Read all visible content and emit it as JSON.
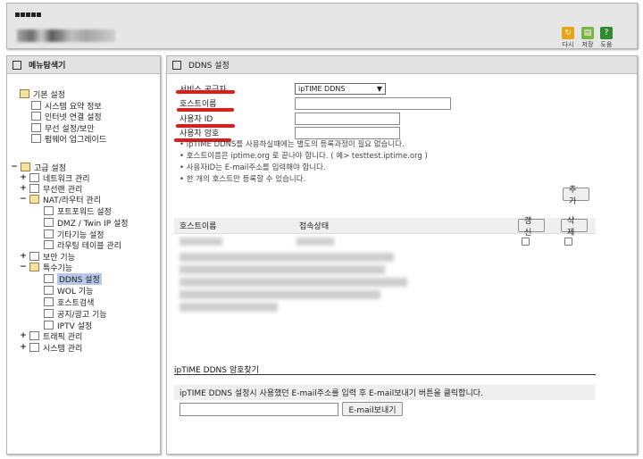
{
  "header": {
    "buttons": [
      {
        "label": "다시",
        "icon": "refresh-icon",
        "color": "#e8a317"
      },
      {
        "label": "저장",
        "icon": "save-icon",
        "color": "#7cb342"
      },
      {
        "label": "도움",
        "icon": "help-icon",
        "color": "#2e8b2e"
      }
    ]
  },
  "sidebar": {
    "title": "메뉴탐색기",
    "basic": {
      "label": "기본 설정",
      "items": [
        "시스템 요약 정보",
        "인터넷 연결 설정",
        "무선 설정/보안",
        "펌웨어 업그레이드"
      ]
    },
    "advanced": {
      "label": "고급 설정",
      "network": "네트워크 관리",
      "wireless": "무선랜 관리",
      "nat": {
        "label": "NAT/라우터 관리",
        "items": [
          "포트포워드 설정",
          "DMZ / Twin IP 설정",
          "기타기능 설정",
          "라우팅 테이블 관리"
        ]
      },
      "security": "보안 기능",
      "special": {
        "label": "특수기능",
        "items": [
          "DDNS 설정",
          "WOL 기능",
          "호스트검색",
          "공지/광고 기능",
          "IPTV 설정"
        ]
      },
      "traffic": "트래픽 관리",
      "system": "시스템 관리"
    }
  },
  "main": {
    "title": "DDNS 설정",
    "form": {
      "provider_label": "서비스 공급자",
      "provider_value": "ipTIME DDNS",
      "host_label": "호스트이름",
      "user_label": "사용자 ID",
      "password_label": "사용자 암호"
    },
    "notes": [
      "ipTIME DDNS를 사용하실때에는 별도의 등록과정이 필요 없습니다.",
      "호스트이름은 iptime.org 로 끝나야 합니다. ( 예> testtest.iptime.org )",
      "사용자ID는 E-mail주소를 입력해야 합니다.",
      "한 개의 호스트만 등록할 수 있습니다."
    ],
    "add_button": "추가",
    "table": {
      "col_host": "호스트이름",
      "col_status": "접속상태",
      "col_renew": "갱신",
      "col_delete": "삭제"
    },
    "password_finder": {
      "title": "ipTIME DDNS 암호찾기",
      "instruction": "ipTIME DDNS 설정시 사용했던 E-mail주소를 입력 후 E-mail보내기 버튼을 클릭합니다.",
      "send_button": "E-mail보내기"
    }
  },
  "colors": {
    "highlight": "#e31a1a",
    "selection": "#b8c8e8"
  }
}
